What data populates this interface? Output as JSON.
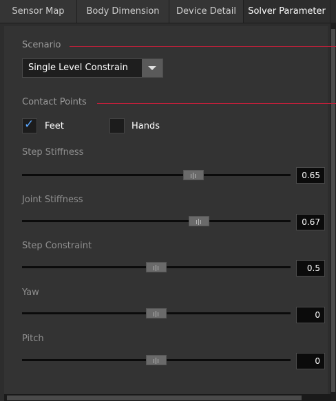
{
  "tabs": [
    {
      "label": "Sensor Map"
    },
    {
      "label": "Body Dimension"
    },
    {
      "label": "Device Detail"
    },
    {
      "label": "Solver Parameter"
    }
  ],
  "scenario": {
    "section_label": "Scenario",
    "selected": "Single Level Constrain"
  },
  "contact_points": {
    "section_label": "Contact Points",
    "feet": {
      "label": "Feet",
      "checked": true
    },
    "hands": {
      "label": "Hands",
      "checked": false
    }
  },
  "sliders": [
    {
      "label": "Step Stiffness",
      "value": "0.65",
      "level": 0.65
    },
    {
      "label": "Joint Stiffness",
      "value": "0.67",
      "level": 0.67
    },
    {
      "label": "Step Constraint",
      "value": "0.5",
      "level": 0.5
    },
    {
      "label": "Yaw",
      "value": "0",
      "level": 0.5
    },
    {
      "label": "Pitch",
      "value": "0",
      "level": 0.5
    }
  ],
  "colors": {
    "accent_line": "#c0203a",
    "check": "#5aa7ff",
    "panel": "#333333"
  }
}
